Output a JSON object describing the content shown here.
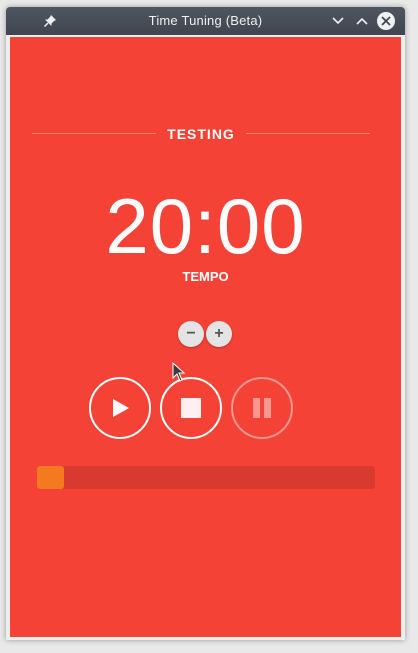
{
  "window": {
    "title": "Time Tuning (Beta)"
  },
  "icons": {
    "pin": "pin-icon",
    "minimize": "chevron-down-icon",
    "maximize": "chevron-up-icon",
    "close": "close-icon"
  },
  "session": {
    "header": "TESTING",
    "time": "20:00",
    "mode": "TEMPO"
  },
  "stepper": {
    "decrement_label": "−",
    "increment_label": "+"
  },
  "controls": {
    "play": "play-icon",
    "stop": "stop-icon",
    "pause": "pause-icon",
    "pause_enabled": false
  },
  "progress": {
    "fraction": 0.08
  },
  "colors": {
    "background": "#f44336",
    "progress_track": "#d93a30",
    "progress_fill": "#f57a1f"
  }
}
